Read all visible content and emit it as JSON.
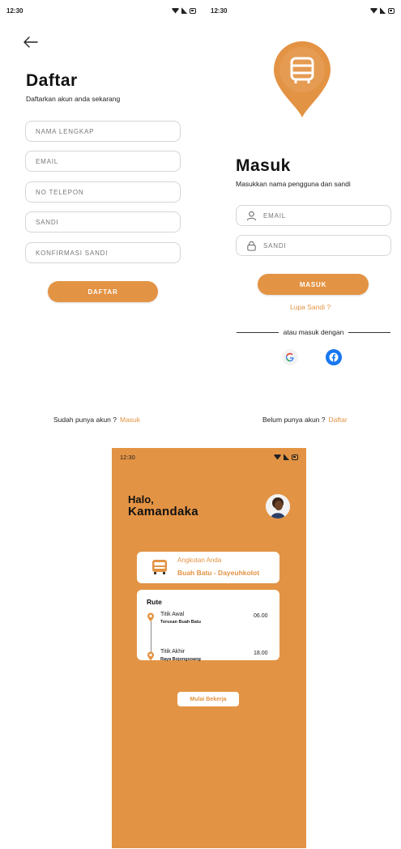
{
  "register": {
    "status_time": "12:30",
    "title": "Daftar",
    "subtitle": "Daftarkan akun anda sekarang",
    "fields": {
      "name": "NAMA LENGKAP",
      "email": "EMAIL",
      "phone": "NO TELEPON",
      "password": "SANDI",
      "confirm": "KONFIRMASI SANDI"
    },
    "submit_label": "DAFTAR",
    "footer_text": "Sudah punya akun ?",
    "footer_link": "Masuk"
  },
  "login": {
    "status_time": "12:30",
    "title": "Masuk",
    "subtitle": "Masukkan nama pengguna dan sandi",
    "fields": {
      "email": "EMAIL",
      "password": "SANDI"
    },
    "submit_label": "MASUK",
    "forgot_label": "Lupa Sandi ?",
    "divider_text": "atau masuk dengan",
    "footer_text": "Belum punya akun ?",
    "footer_link": "Daftar"
  },
  "home": {
    "status_time": "12:30",
    "greeting_line1": "Halo,",
    "greeting_line2": "Kamandaka",
    "vehicle_label": "Angkutan Anda",
    "vehicle_route": "Buah Batu - Dayeuhkolot",
    "route_title": "Rute",
    "stops": [
      {
        "name": "Titik Awal",
        "detail": "Terusan Buah Batu",
        "time": "06.00"
      },
      {
        "name": "Titik Akhir",
        "detail": "Raya Bojongsoang",
        "time": "18.00"
      }
    ],
    "start_label": "Mulai Bekerja"
  },
  "colors": {
    "accent": "#e39344",
    "google_blue": "#4285f4",
    "facebook_blue": "#1877f2"
  }
}
